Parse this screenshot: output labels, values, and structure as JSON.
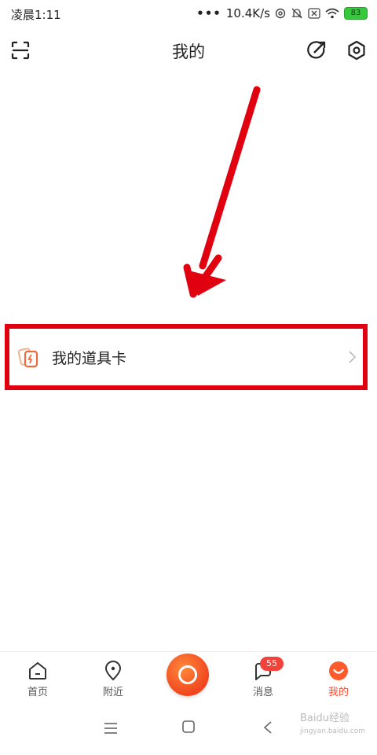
{
  "status_bar": {
    "time": "凌晨1:11",
    "network_speed": "10.4K/s",
    "battery": "83"
  },
  "header": {
    "title": "我的",
    "icons": [
      "scan-icon",
      "share-icon",
      "settings-icon"
    ]
  },
  "menu": {
    "prop_card_label": "我的道具卡"
  },
  "tabbar": {
    "home_label": "首页",
    "nearby_label": "附近",
    "messages_label": "消息",
    "messages_badge": "55",
    "mine_label": "我的"
  },
  "watermark": {
    "text": "Baidu经验",
    "url": "jingyan.baidu.com"
  },
  "colors": {
    "accent": "#ff4a2c",
    "annotation_red": "#e10010",
    "battery_green": "#35c93b"
  }
}
